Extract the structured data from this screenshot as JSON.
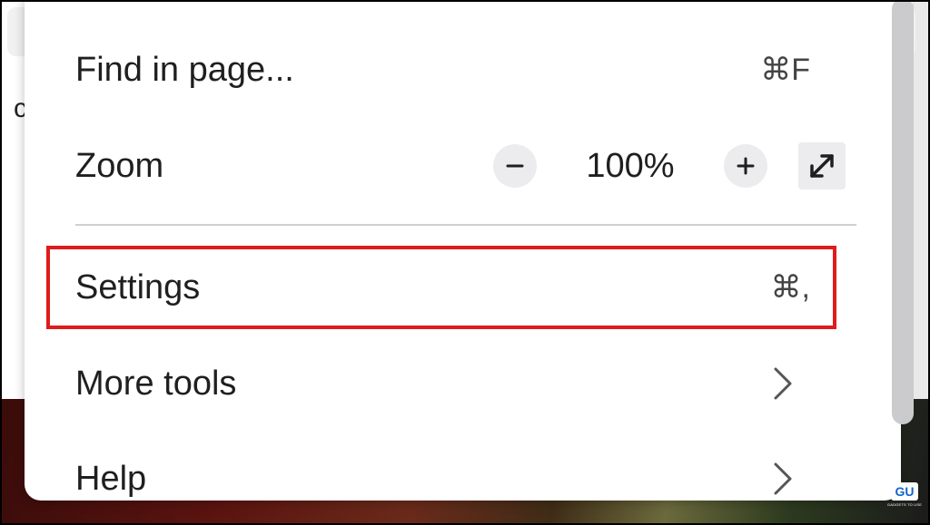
{
  "menu": {
    "find": {
      "label": "Find in page...",
      "shortcut": "⌘F"
    },
    "zoom": {
      "label": "Zoom",
      "value": "100%",
      "decrease_icon": "minus-icon",
      "increase_icon": "plus-icon",
      "fullscreen_icon": "fullscreen-icon"
    },
    "settings": {
      "label": "Settings",
      "shortcut": "⌘,"
    },
    "more_tools": {
      "label": "More tools",
      "icon": "chevron-right-icon"
    },
    "help": {
      "label": "Help",
      "icon": "chevron-right-icon"
    }
  },
  "background": {
    "partial_text": "c"
  },
  "colors": {
    "highlight": "#e01b1b",
    "menu_bg": "#ffffff",
    "control_bg": "#ececee",
    "divider": "#cfcfcf"
  },
  "watermark": {
    "logo": "GU",
    "caption": "GADGETS TO USE"
  }
}
